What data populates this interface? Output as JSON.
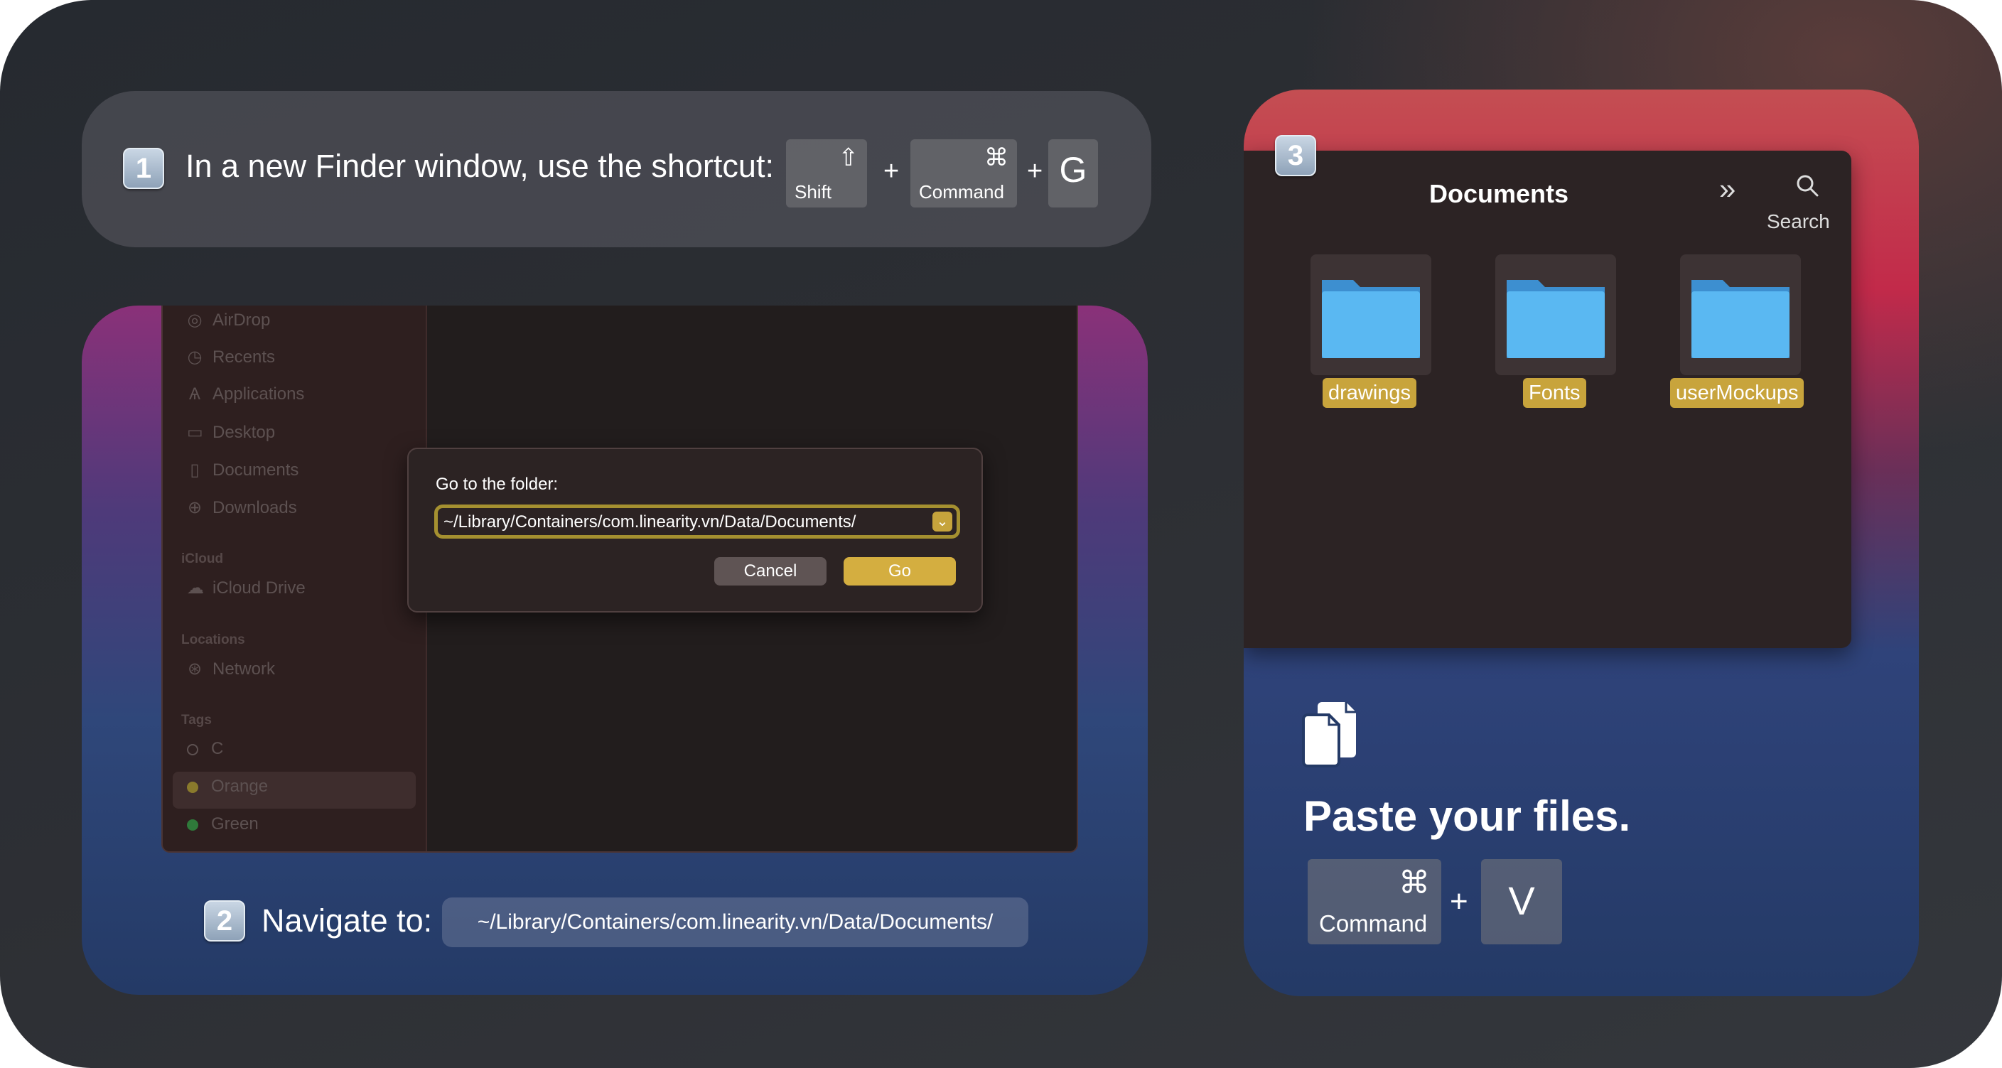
{
  "step1": {
    "number": "1",
    "text": "In a new Finder window, use the shortcut:",
    "keys": {
      "shift_symbol": "⇧",
      "shift_label": "Shift",
      "plus1": "+",
      "command_symbol": "⌘",
      "command_label": "Command",
      "plus2": "+",
      "g": "G"
    }
  },
  "step2": {
    "number": "2",
    "text": "Navigate to:",
    "path": "~/Library/Containers/com.linearity.vn/Data/Documents/"
  },
  "sidebar": {
    "items": [
      {
        "label": "AirDrop"
      },
      {
        "label": "Recents"
      },
      {
        "label": "Applications"
      },
      {
        "label": "Desktop"
      },
      {
        "label": "Documents"
      },
      {
        "label": "Downloads"
      }
    ],
    "icloud_heading": "iCloud",
    "icloud_drive": "iCloud Drive",
    "locations_heading": "Locations",
    "network": "Network",
    "tags_heading": "Tags",
    "tags": [
      {
        "label": "C"
      },
      {
        "label": "Orange",
        "color": "#8a7a2c"
      },
      {
        "label": "Green",
        "color": "#2f7a3a"
      }
    ]
  },
  "dialog": {
    "label": "Go to the folder:",
    "value": "~/Library/Containers/com.linearity.vn/Data/Documents/",
    "cancel": "Cancel",
    "go": "Go"
  },
  "step3": {
    "number": "3",
    "window_title": "Documents",
    "search_label": "Search",
    "folders": [
      {
        "name": "drawings"
      },
      {
        "name": "Fonts"
      },
      {
        "name": "userMockups"
      }
    ],
    "paste_title": "Paste your files.",
    "keys": {
      "command_symbol": "⌘",
      "command_label": "Command",
      "plus": "+",
      "v": "V"
    }
  },
  "colors": {
    "accent_gold": "#d4ae40",
    "folder_blue": "#5ab8f2"
  }
}
